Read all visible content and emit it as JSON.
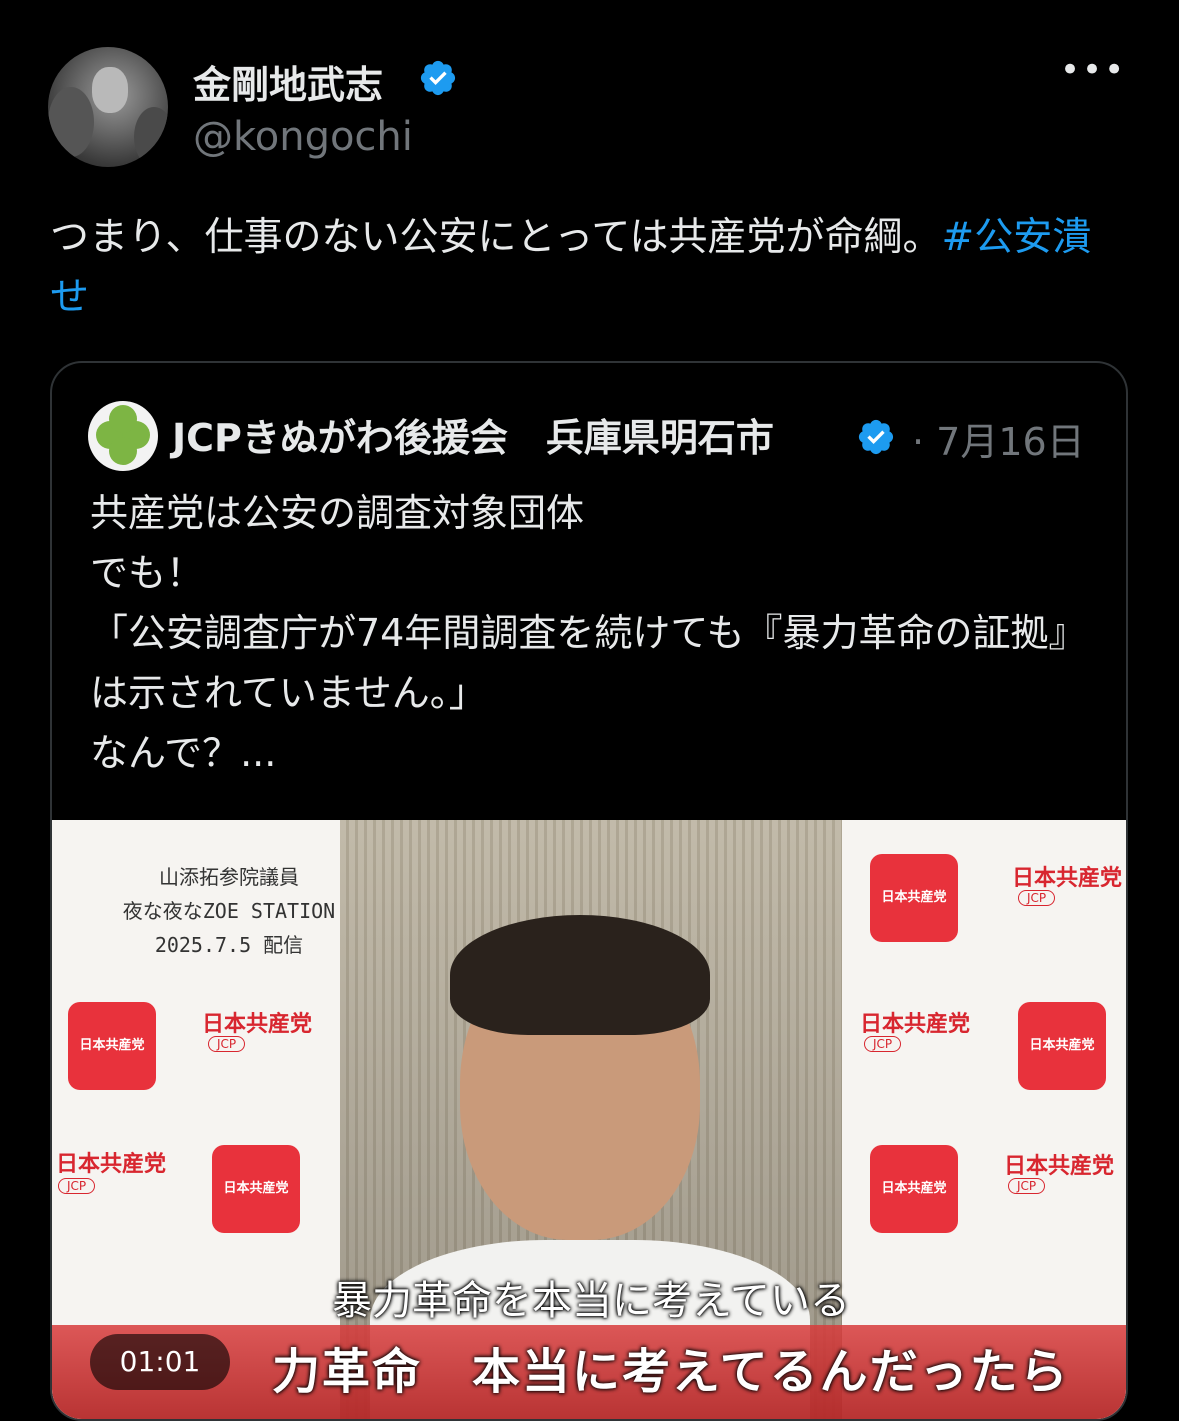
{
  "author": {
    "display_name": "金剛地武志",
    "handle": "@kongochi",
    "verified": true,
    "badge_icon": "verified-badge-icon"
  },
  "more_label": "•••",
  "tweet": {
    "text": "つまり、仕事のない公安にとっては共産党が命綱。",
    "hashtag": "#公安潰せ"
  },
  "quoted": {
    "name": "JCPきぬがわ後援会　兵庫県明石市",
    "verified": true,
    "date": "· 7月16日",
    "lines": [
      "共産党は公安の調査対象団体",
      "でも！",
      "「公安調査庁が74年間調査を続けても『暴力革命の証拠』は示されていません。」",
      "なんで？..."
    ],
    "media": {
      "stream_title_lines": [
        "山添拓参院議員",
        "夜な夜なZOE STATION",
        "2025.7.5 配信"
      ],
      "jcp_box_label": "日本共産党",
      "jcp_logo_text": "日本共産党",
      "jcp_sub_text": "JCP",
      "caption": "暴力革命を本当に考えている",
      "banner": "力革命　本当に考えてるんだったら",
      "timer": "01:01"
    }
  },
  "colors": {
    "background": "#000000",
    "text": "#e7e9ea",
    "secondary": "#71767b",
    "link": "#1d9bf0",
    "verified": "#1d9bf0",
    "border": "#2f3336",
    "jcp_red": "#e8323c"
  }
}
